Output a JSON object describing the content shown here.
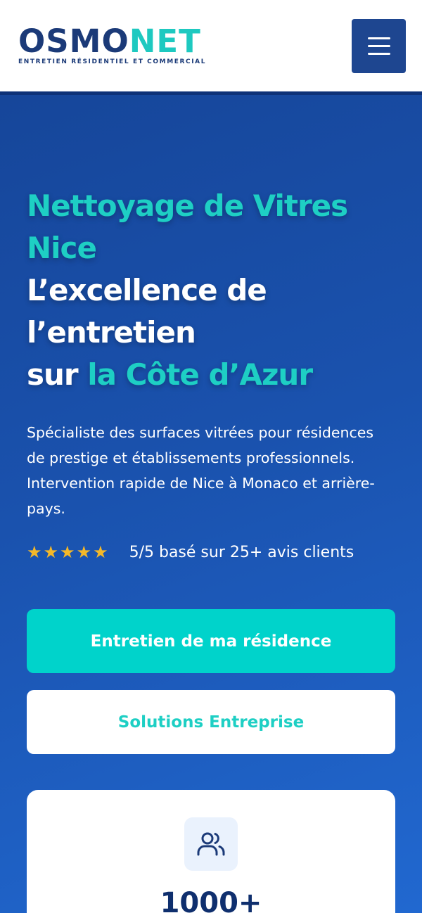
{
  "header": {
    "logo_part1": "OSMO",
    "logo_part2": "NET",
    "tagline": "ENTRETIEN RÉSIDENTIEL ET COMMERCIAL",
    "menu_icon": "hamburger-icon"
  },
  "hero": {
    "title_line1": "Nettoyage de Vitres",
    "title_line2": "Nice",
    "title_line3": "L’excellence de",
    "title_line4": "l’entretien",
    "title_line5_white": "sur ",
    "title_line5_teal": "la Côte d’Azur",
    "description": "Spécialiste des surfaces vitrées pour résidences de prestige et établissements professionnels. Intervention rapide de Nice à Monaco et arrière-pays.",
    "stars": "★★★★★",
    "rating_value": 5,
    "rating_text": "5/5 basé sur 25+ avis clients",
    "primary_button": "Entretien de ma résidence",
    "secondary_button": "Solutions Entreprise"
  },
  "stat": {
    "icon": "users-icon",
    "value": "1000+"
  },
  "colors": {
    "brand_dark": "#1b3a78",
    "brand_teal": "#1ecfc4",
    "menu_button": "#1e4690",
    "star": "#f4b829"
  }
}
